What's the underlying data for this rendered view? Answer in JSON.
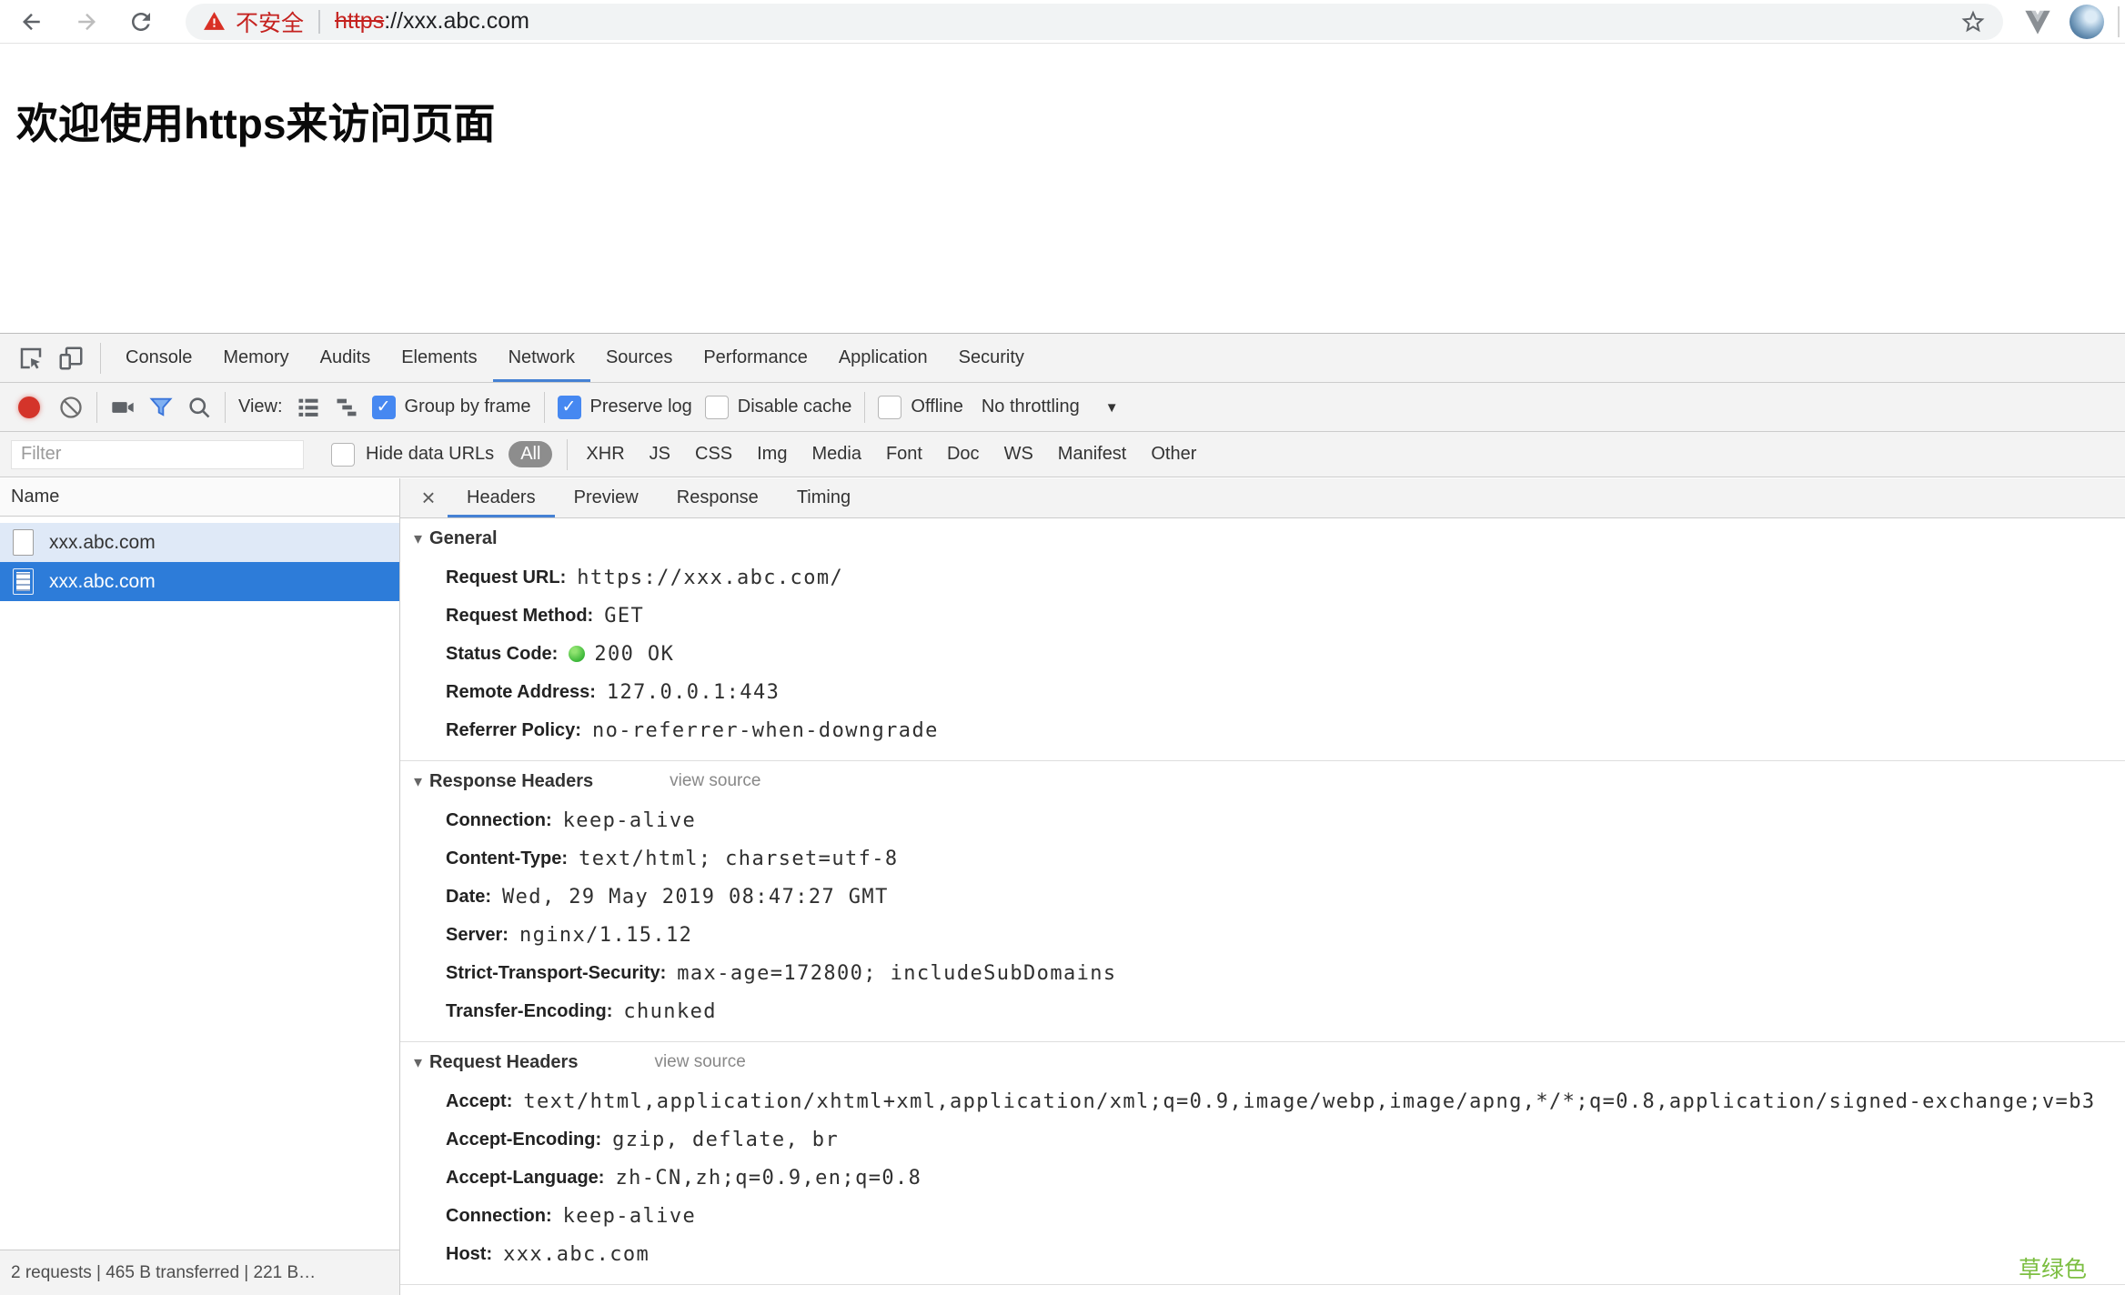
{
  "colors": {
    "accent": "#4581d4",
    "checkbox_blue": "#4688f1",
    "selected_row": "#2d7cd9",
    "record_red": "#d4342a",
    "status_green": "#3db83a",
    "warning_red": "#c5221f",
    "watermark_green": "#7cbe41"
  },
  "browser": {
    "security_warning": "不安全",
    "url_scheme": "https",
    "url_rest": "://xxx.abc.com"
  },
  "page": {
    "heading": "欢迎使用https来访问页面"
  },
  "devtools": {
    "main_tabs": [
      "Console",
      "Memory",
      "Audits",
      "Elements",
      "Network",
      "Sources",
      "Performance",
      "Application",
      "Security"
    ],
    "toolbar": {
      "view_label": "View:",
      "group_by_frame": "Group by frame",
      "preserve_log": "Preserve log",
      "disable_cache": "Disable cache",
      "offline": "Offline",
      "throttling": "No throttling"
    },
    "filter_bar": {
      "placeholder": "Filter",
      "hide_data_urls": "Hide data URLs",
      "types": [
        "All",
        "XHR",
        "JS",
        "CSS",
        "Img",
        "Media",
        "Font",
        "Doc",
        "WS",
        "Manifest",
        "Other"
      ]
    },
    "request_list": {
      "header": "Name",
      "rows": [
        {
          "name": "xxx.abc.com"
        },
        {
          "name": "xxx.abc.com"
        }
      ]
    },
    "detail": {
      "close": "×",
      "tabs": [
        "Headers",
        "Preview",
        "Response",
        "Timing"
      ],
      "sections": [
        {
          "title": "General",
          "fields": [
            {
              "label": "Request URL:",
              "value": "https://xxx.abc.com/"
            },
            {
              "label": "Request Method:",
              "value": "GET"
            },
            {
              "label": "Status Code:",
              "value": "200 OK"
            },
            {
              "label": "Remote Address:",
              "value": "127.0.0.1:443"
            },
            {
              "label": "Referrer Policy:",
              "value": "no-referrer-when-downgrade"
            }
          ]
        },
        {
          "title": "Response Headers",
          "view_source": "view source",
          "fields": [
            {
              "label": "Connection:",
              "value": "keep-alive"
            },
            {
              "label": "Content-Type:",
              "value": "text/html; charset=utf-8"
            },
            {
              "label": "Date:",
              "value": "Wed, 29 May 2019 08:47:27 GMT"
            },
            {
              "label": "Server:",
              "value": "nginx/1.15.12"
            },
            {
              "label": "Strict-Transport-Security:",
              "value": "max-age=172800; includeSubDomains"
            },
            {
              "label": "Transfer-Encoding:",
              "value": "chunked"
            }
          ]
        },
        {
          "title": "Request Headers",
          "view_source": "view source",
          "fields": [
            {
              "label": "Accept:",
              "value": "text/html,application/xhtml+xml,application/xml;q=0.9,image/webp,image/apng,*/*;q=0.8,application/signed-exchange;v=b3"
            },
            {
              "label": "Accept-Encoding:",
              "value": "gzip, deflate, br"
            },
            {
              "label": "Accept-Language:",
              "value": "zh-CN,zh;q=0.9,en;q=0.8"
            },
            {
              "label": "Connection:",
              "value": "keep-alive"
            },
            {
              "label": "Host:",
              "value": "xxx.abc.com"
            }
          ]
        }
      ]
    },
    "status_bar": "2 requests | 465 B transferred | 221 B…"
  },
  "watermark": {
    "text": "草绿色"
  }
}
